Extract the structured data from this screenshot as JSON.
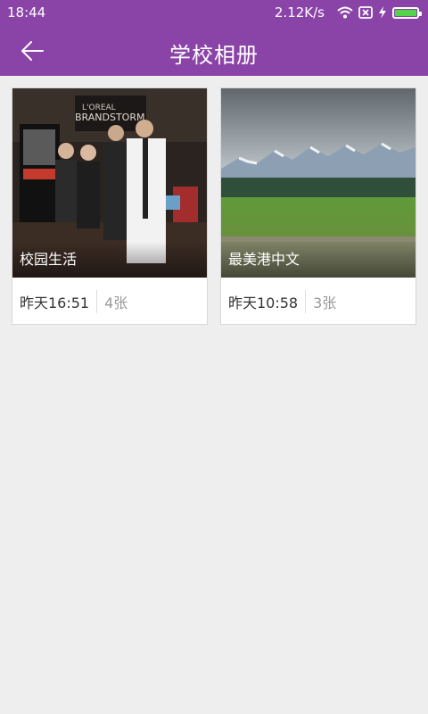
{
  "status_bar": {
    "time": "18:44",
    "net_speed": "2.12K/s",
    "icons": [
      "wifi-icon",
      "sim-blocked-icon",
      "charging-icon",
      "battery-icon"
    ],
    "battery_level": 1.0
  },
  "app_bar": {
    "title": "学校相册",
    "back_icon": "arrow-left-icon"
  },
  "colors": {
    "primary": "#8a44a8",
    "background": "#eeeeee",
    "battery": "#52d34a"
  },
  "albums": [
    {
      "name": "校园生活",
      "time": "昨天16:51",
      "count": "4张"
    },
    {
      "name": "最美港中文",
      "time": "昨天10:58",
      "count": "3张"
    }
  ]
}
